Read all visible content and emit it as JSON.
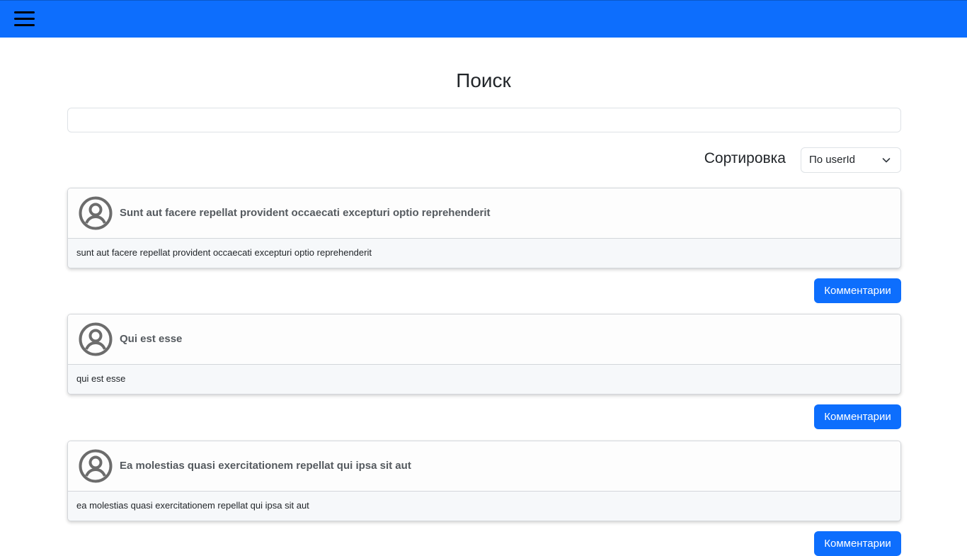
{
  "colors": {
    "navbar": "#0d6efd",
    "button": "#0d6efd"
  },
  "navbar": {
    "menu_icon": "hamburger-menu-icon"
  },
  "page": {
    "title": "Поиск"
  },
  "search": {
    "value": "",
    "placeholder": ""
  },
  "sort": {
    "label": "Сортировка",
    "selected": "По userId",
    "icon": "chevron-down-icon"
  },
  "posts": [
    {
      "title": "Sunt aut facere repellat provident occaecati excepturi optio reprehenderit",
      "body": "sunt aut facere repellat provident occaecati excepturi optio reprehenderit",
      "button": "Комментарии",
      "icon": "user-avatar-icon"
    },
    {
      "title": "Qui est esse",
      "body": "qui est esse",
      "button": "Комментарии",
      "icon": "user-avatar-icon"
    },
    {
      "title": "Ea molestias quasi exercitationem repellat qui ipsa sit aut",
      "body": "ea molestias quasi exercitationem repellat qui ipsa sit aut",
      "button": "Комментарии",
      "icon": "user-avatar-icon"
    }
  ]
}
